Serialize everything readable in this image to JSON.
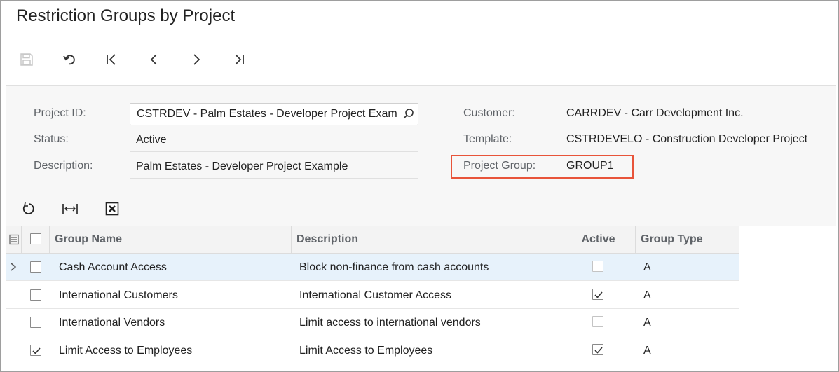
{
  "page": {
    "title": "Restriction Groups by Project"
  },
  "toolbar": {
    "buttons": [
      {
        "name": "save-icon",
        "enabled": false
      },
      {
        "name": "undo-icon",
        "enabled": true
      },
      {
        "name": "first-record-icon",
        "enabled": true
      },
      {
        "name": "previous-record-icon",
        "enabled": true
      },
      {
        "name": "next-record-icon",
        "enabled": true
      },
      {
        "name": "last-record-icon",
        "enabled": true
      }
    ]
  },
  "form": {
    "project_id_label": "Project ID:",
    "project_id_value": "CSTRDEV - Palm Estates - Developer Project Example",
    "status_label": "Status:",
    "status_value": "Active",
    "description_label": "Description:",
    "description_value": "Palm Estates - Developer Project Example",
    "customer_label": "Customer:",
    "customer_value": "CARRDEV - Carr Development Inc.",
    "template_label": "Template:",
    "template_value": "CSTRDEVELO - Construction Developer Project",
    "project_group_label": "Project Group:",
    "project_group_value": "GROUP1",
    "highlight_color": "#e8543a"
  },
  "grid_toolbar": {
    "buttons": [
      "refresh-icon",
      "fit-columns-icon",
      "export-excel-icon"
    ]
  },
  "grid": {
    "columns": {
      "group_name": "Group Name",
      "description": "Description",
      "active": "Active",
      "group_type": "Group Type"
    },
    "rows": [
      {
        "selected_indicator": true,
        "checked": false,
        "group_name": "Cash Account Access",
        "description": "Block non-finance from cash accounts",
        "active": false,
        "group_type": "A"
      },
      {
        "selected_indicator": false,
        "checked": false,
        "group_name": "International Customers",
        "description": "International Customer Access",
        "active": true,
        "group_type": "A"
      },
      {
        "selected_indicator": false,
        "checked": false,
        "group_name": "International Vendors",
        "description": "Limit access to international vendors",
        "active": false,
        "group_type": "A"
      },
      {
        "selected_indicator": false,
        "checked": true,
        "group_name": "Limit Access to Employees",
        "description": "Limit Access to Employees",
        "active": true,
        "group_type": "A"
      }
    ]
  }
}
